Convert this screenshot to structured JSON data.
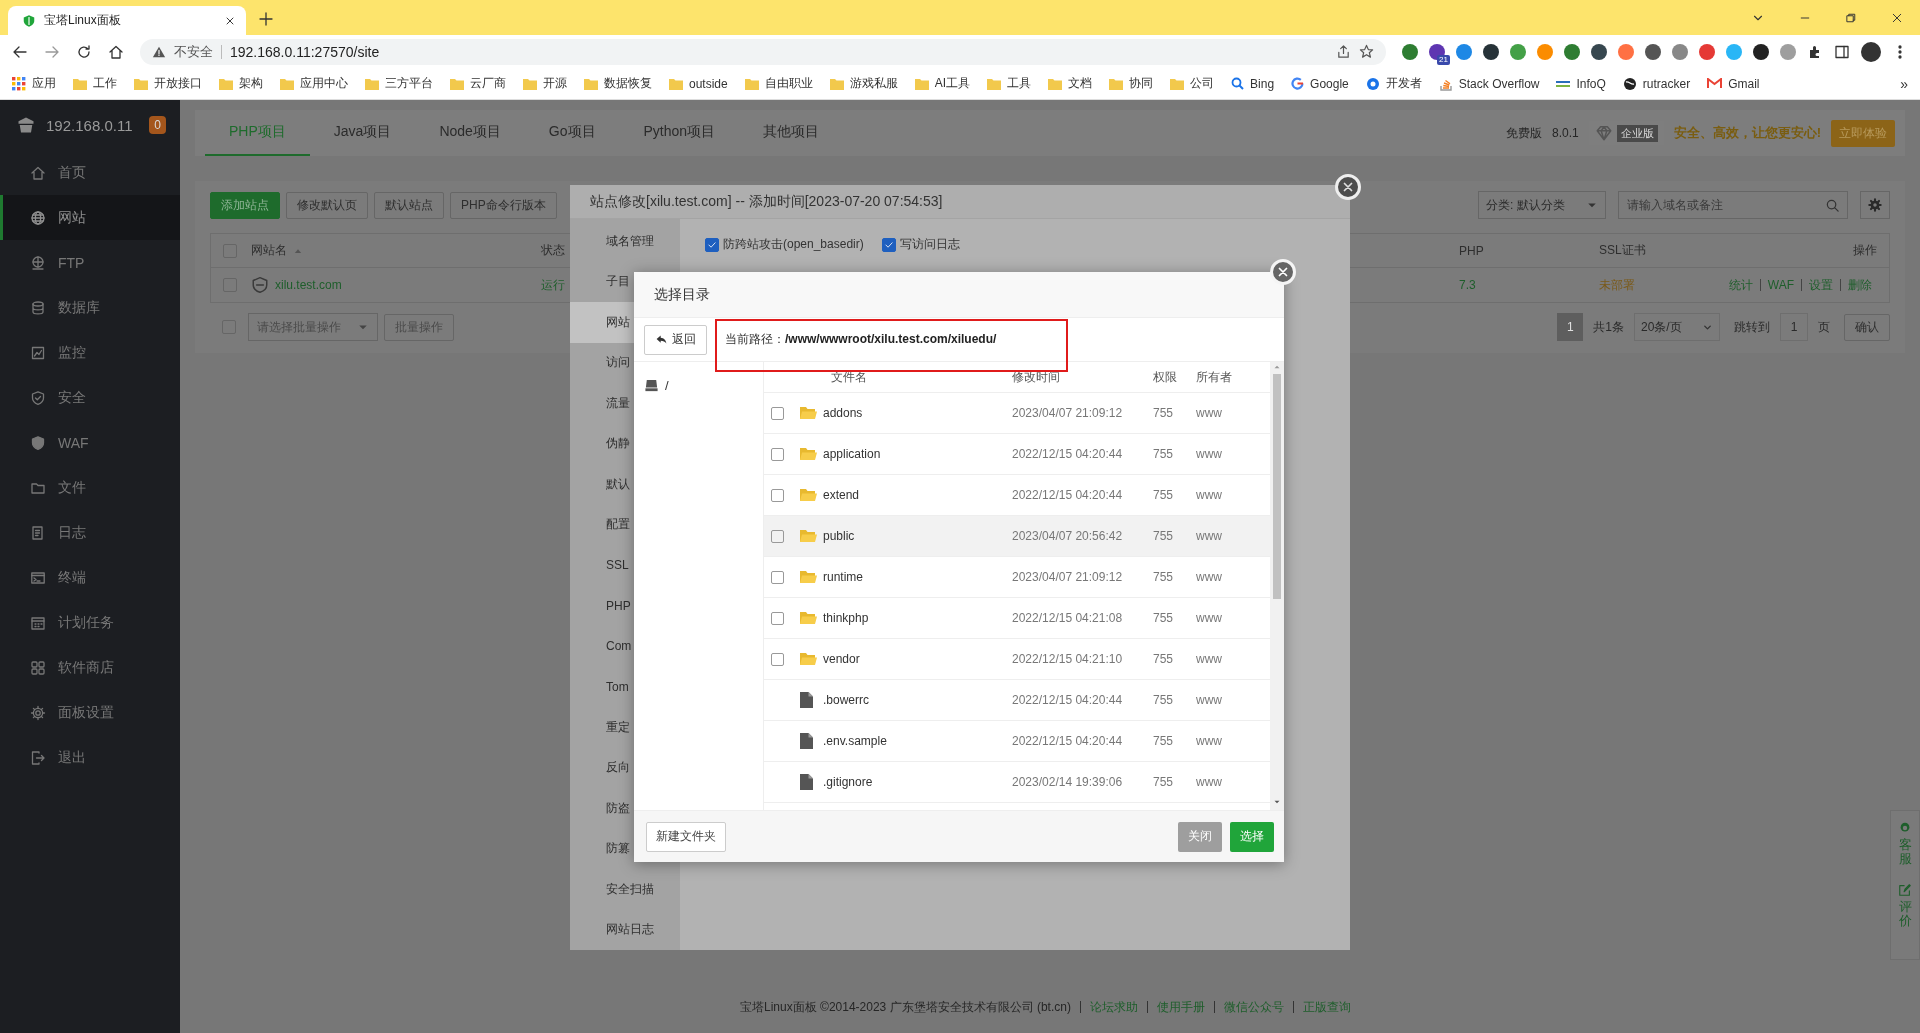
{
  "browser": {
    "tab": {
      "title": "宝塔Linux面板"
    },
    "address": {
      "security": "不安全",
      "url": "192.168.0.11:27570/site"
    },
    "extension_badges": [
      "21"
    ],
    "bookmarks": [
      {
        "kind": "apps",
        "label": "应用"
      },
      {
        "kind": "folder",
        "label": "工作"
      },
      {
        "kind": "folder",
        "label": "开放接口"
      },
      {
        "kind": "folder",
        "label": "架构"
      },
      {
        "kind": "folder",
        "label": "应用中心"
      },
      {
        "kind": "folder",
        "label": "三方平台"
      },
      {
        "kind": "folder",
        "label": "云厂商"
      },
      {
        "kind": "folder",
        "label": "开源"
      },
      {
        "kind": "folder",
        "label": "数据恢复"
      },
      {
        "kind": "folder",
        "label": "outside"
      },
      {
        "kind": "folder",
        "label": "自由职业"
      },
      {
        "kind": "folder",
        "label": "游戏私服"
      },
      {
        "kind": "folder",
        "label": "AI工具"
      },
      {
        "kind": "folder",
        "label": "工具"
      },
      {
        "kind": "folder",
        "label": "文档"
      },
      {
        "kind": "folder",
        "label": "协同"
      },
      {
        "kind": "folder",
        "label": "公司"
      },
      {
        "kind": "search",
        "label": "Bing"
      },
      {
        "kind": "google",
        "label": "Google"
      },
      {
        "kind": "dev",
        "label": "开发者"
      },
      {
        "kind": "stack",
        "label": "Stack Overflow"
      },
      {
        "kind": "infoq",
        "label": "InfoQ"
      },
      {
        "kind": "globe",
        "label": "rutracker"
      },
      {
        "kind": "mail",
        "label": "Gmail"
      }
    ],
    "bookmarks_more": "»"
  },
  "sidebar": {
    "host": "192.168.0.11",
    "badge": "0",
    "items": [
      {
        "label": "首页",
        "kind": "home",
        "selected": false
      },
      {
        "label": "网站",
        "kind": "globe",
        "selected": true
      },
      {
        "label": "FTP",
        "kind": "ftp",
        "selected": false
      },
      {
        "label": "数据库",
        "kind": "database",
        "selected": false
      },
      {
        "label": "监控",
        "kind": "monitor",
        "selected": false
      },
      {
        "label": "安全",
        "kind": "shield",
        "selected": false
      },
      {
        "label": "WAF",
        "kind": "waf",
        "selected": false
      },
      {
        "label": "文件",
        "kind": "folder",
        "selected": false
      },
      {
        "label": "日志",
        "kind": "log",
        "selected": false
      },
      {
        "label": "终端",
        "kind": "terminal",
        "selected": false
      },
      {
        "label": "计划任务",
        "kind": "calendar",
        "selected": false
      },
      {
        "label": "软件商店",
        "kind": "apps",
        "selected": false
      },
      {
        "label": "面板设置",
        "kind": "gear",
        "selected": false
      },
      {
        "label": "退出",
        "kind": "logout",
        "selected": false
      }
    ]
  },
  "project_tabs": [
    {
      "label": "PHP项目",
      "selected": true
    },
    {
      "label": "Java项目",
      "selected": false
    },
    {
      "label": "Node项目",
      "selected": false
    },
    {
      "label": "Go项目",
      "selected": false
    },
    {
      "label": "Python项目",
      "selected": false
    },
    {
      "label": "其他项目",
      "selected": false
    }
  ],
  "edition": {
    "label": "免费版",
    "version": "8.0.1",
    "enterprise_badge": "企业版",
    "slogan": "安全、高效，让您更安心!",
    "trial_button": "立即体验"
  },
  "site_toolbar": {
    "buttons": [
      {
        "label": "添加站点",
        "kind": "primary"
      },
      {
        "label": "修改默认页",
        "kind": "default"
      },
      {
        "label": "默认站点",
        "kind": "default"
      },
      {
        "label": "PHP命令行版本",
        "kind": "default"
      }
    ],
    "category": "分类: 默认分类",
    "search_placeholder": "请输入域名或备注"
  },
  "site_table": {
    "header_checked": false,
    "columns": [
      "网站名",
      "状态",
      "PHP",
      "SSL证书",
      "操作"
    ],
    "rows": [
      {
        "checked": false,
        "name": "xilu.test.com",
        "status": "运行",
        "php": "7.3",
        "ssl": "未部署",
        "actions": [
          "统计",
          "WAF",
          "设置",
          "删除"
        ]
      }
    ]
  },
  "batch": {
    "checked": false,
    "placeholder": "请选择批量操作",
    "button": "批量操作"
  },
  "pagination": {
    "current": "1",
    "total": "共1条",
    "page_size": "20条/页",
    "jump_label": "跳转到",
    "jump_value": "1",
    "page_unit": "页",
    "confirm": "确认"
  },
  "site_dialog": {
    "title": "站点修改[xilu.test.com] -- 添加时间[2023-07-20 07:54:53]",
    "menu": [
      {
        "label": "域名管理",
        "selected": false
      },
      {
        "label": "子目",
        "selected": false
      },
      {
        "label": "网站",
        "selected": true
      },
      {
        "label": "访问",
        "selected": false
      },
      {
        "label": "流量",
        "selected": false
      },
      {
        "label": "伪静",
        "selected": false
      },
      {
        "label": "默认",
        "selected": false
      },
      {
        "label": "配置",
        "selected": false
      },
      {
        "label": "SSL",
        "selected": false
      },
      {
        "label": "PHP",
        "selected": false
      },
      {
        "label": "Com",
        "selected": false
      },
      {
        "label": "Tom",
        "selected": false
      },
      {
        "label": "重定",
        "selected": false
      },
      {
        "label": "反向",
        "selected": false
      },
      {
        "label": "防盗",
        "selected": false
      },
      {
        "label": "防篡",
        "selected": false
      },
      {
        "label": "安全扫描",
        "selected": false
      },
      {
        "label": "网站日志",
        "selected": false
      }
    ],
    "options": [
      {
        "label": "防跨站攻击(open_basedir)",
        "checked": true
      },
      {
        "label": "写访问日志",
        "checked": true
      }
    ]
  },
  "dir_dialog": {
    "title": "选择目录",
    "back_button": "返回",
    "path": "当前路径：**/www/wwwroot/xilu.test.com/xiluedu/**",
    "tree": [
      {
        "label": "/"
      }
    ],
    "columns": [
      "文件名",
      "修改时间",
      "权限",
      "所有者"
    ],
    "files": [
      {
        "kind": "folder",
        "checked": false,
        "highlighted": false,
        "name": "addons",
        "modified": "2023/04/07 21:09:12",
        "permission": "755",
        "owner": "www"
      },
      {
        "kind": "folder",
        "checked": false,
        "highlighted": false,
        "name": "application",
        "modified": "2022/12/15 04:20:44",
        "permission": "755",
        "owner": "www"
      },
      {
        "kind": "folder",
        "checked": false,
        "highlighted": false,
        "name": "extend",
        "modified": "2022/12/15 04:20:44",
        "permission": "755",
        "owner": "www"
      },
      {
        "kind": "folder",
        "checked": false,
        "highlighted": true,
        "name": "public",
        "modified": "2023/04/07 20:56:42",
        "permission": "755",
        "owner": "www"
      },
      {
        "kind": "folder",
        "checked": false,
        "highlighted": false,
        "name": "runtime",
        "modified": "2023/04/07 21:09:12",
        "permission": "755",
        "owner": "www"
      },
      {
        "kind": "folder",
        "checked": false,
        "highlighted": false,
        "name": "thinkphp",
        "modified": "2022/12/15 04:21:08",
        "permission": "755",
        "owner": "www"
      },
      {
        "kind": "folder",
        "checked": false,
        "highlighted": false,
        "name": "vendor",
        "modified": "2022/12/15 04:21:10",
        "permission": "755",
        "owner": "www"
      },
      {
        "kind": "file",
        "highlighted": false,
        "name": ".bowerrc",
        "modified": "2022/12/15 04:20:44",
        "permission": "755",
        "owner": "www"
      },
      {
        "kind": "file",
        "highlighted": false,
        "name": ".env.sample",
        "modified": "2022/12/15 04:20:44",
        "permission": "755",
        "owner": "www"
      },
      {
        "kind": "file",
        "highlighted": false,
        "name": ".gitignore",
        "modified": "2023/02/14 19:39:06",
        "permission": "755",
        "owner": "www"
      }
    ],
    "new_folder_button": "新建文件夹",
    "close_button": {
      "label": "关闭",
      "disabled": true
    },
    "select_button": "选择"
  },
  "help_widget": [
    {
      "label": "客服",
      "kind": "service"
    },
    {
      "label": "评价",
      "kind": "review"
    }
  ],
  "footer": {
    "text": "宝塔Linux面板 ©2014-2023 广东堡塔安全技术有限公司 (bt.cn)",
    "links": [
      "论坛求助",
      "使用手册",
      "微信公众号",
      "正版查询"
    ]
  }
}
